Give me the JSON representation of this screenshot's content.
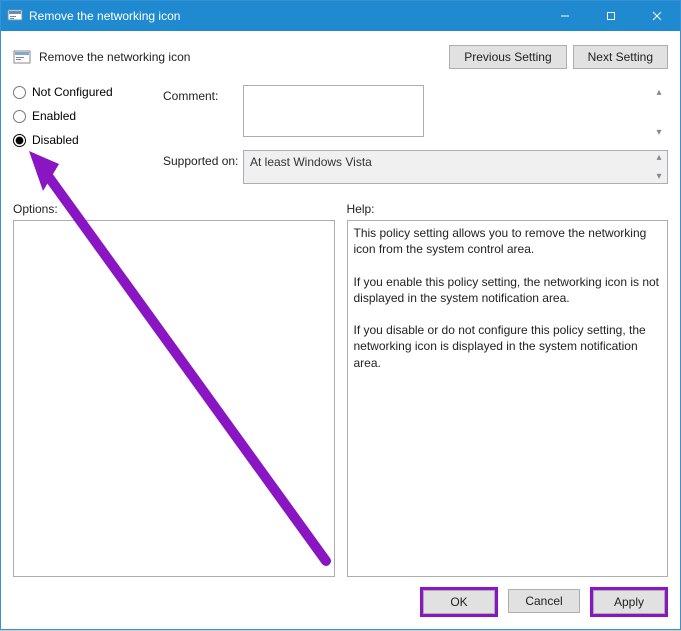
{
  "window": {
    "title": "Remove the networking icon"
  },
  "header": {
    "setting_title": "Remove the networking icon",
    "prev_label": "Previous Setting",
    "next_label": "Next Setting"
  },
  "radios": {
    "not_configured": "Not Configured",
    "enabled": "Enabled",
    "disabled": "Disabled",
    "selected": "disabled"
  },
  "fields": {
    "comment_label": "Comment:",
    "comment_value": "",
    "supported_label": "Supported on:",
    "supported_value": "At least Windows Vista"
  },
  "panes": {
    "options_label": "Options:",
    "options_value": "",
    "help_label": "Help:",
    "help_value": "This policy setting allows you to remove the networking icon from the system control area.\n\nIf you enable this policy setting, the networking icon is not displayed in the system notification area.\n\nIf you disable or do not configure this policy setting, the networking icon is displayed in the system notification area."
  },
  "buttons": {
    "ok": "OK",
    "cancel": "Cancel",
    "apply": "Apply"
  },
  "annotation": {
    "color": "#8a15c2"
  }
}
